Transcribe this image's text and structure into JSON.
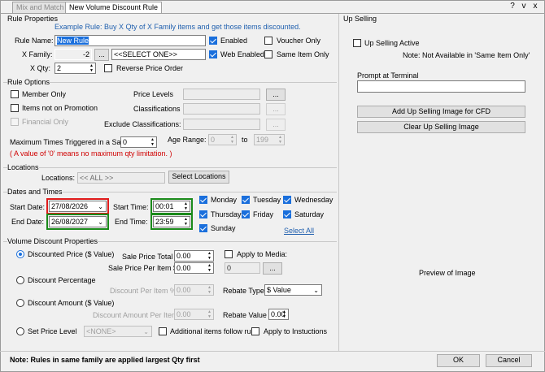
{
  "tabs": [
    "Mix and Match",
    "New Volume Discount Rule"
  ],
  "window_controls": {
    "help": "?",
    "min": "v",
    "close": "x"
  },
  "rule_properties": {
    "title": "Rule Properties",
    "example": "Example Rule: Buy X Qty of X Family items and get those items discounted.",
    "rule_name_label": "Rule Name:",
    "rule_name_value": "New Rule",
    "x_family_label": "X Family:",
    "x_family_value": "-2",
    "x_family_btn": "...",
    "x_family_select": "<<SELECT ONE>>",
    "x_qty_label": "X Qty:",
    "x_qty_value": "2",
    "reverse_price_order": "Reverse Price Order",
    "enabled": "Enabled",
    "web_enabled": "Web Enabled",
    "voucher_only": "Voucher Only",
    "same_item_only": "Same Item Only"
  },
  "rule_options": {
    "title": "Rule Options",
    "member_only": "Member Only",
    "items_not_on_promotion": "Items not on Promotion",
    "financial_only": "Financial Only",
    "price_levels": "Price Levels",
    "classifications": "Classifications",
    "exclude_classifications": "Exclude Classifications:",
    "browse_btn": "...",
    "max_times_label": "Maximum Times Triggered in a Sale:",
    "max_times_value": "0",
    "max_times_note": "( A value of '0' means no maximum qty limitation. )",
    "age_range_label": "Age Range:",
    "age_from": "0",
    "age_to_label": "to",
    "age_to": "199"
  },
  "locations": {
    "title": "Locations",
    "label": "Locations:",
    "value": "<< ALL >>",
    "select_btn": "Select Locations"
  },
  "dates_times": {
    "title": "Dates and Times",
    "start_date_label": "Start Date:",
    "start_date": "27/08/2026",
    "end_date_label": "End Date:",
    "end_date": "26/08/2027",
    "start_time_label": "Start Time:",
    "start_time": "00:01",
    "end_time_label": "End Time:",
    "end_time": "23:59",
    "days": [
      "Monday",
      "Tuesday",
      "Wednesday",
      "Thursday",
      "Friday",
      "Saturday",
      "Sunday"
    ],
    "select_all": "Select All"
  },
  "volume_discount": {
    "title": "Volume Discount Properties",
    "discounted_price": "Discounted Price ($ Value)",
    "sale_price_total_label": "Sale Price Total",
    "sale_price_total": "0.00",
    "sale_price_per_item_label": "Sale Price Per Item $",
    "sale_price_per_item": "0.00",
    "apply_to_media": "Apply to Media:",
    "media_value": "0",
    "media_btn": "...",
    "discount_percentage": "Discount Percentage",
    "discount_per_item_pct_label": "Discount Per Item %",
    "discount_per_item_pct": "0.00",
    "rebate_type_label": "Rebate Type",
    "rebate_type_value": "$ Value",
    "discount_amount": "Discount Amount ($ Value)",
    "discount_amount_per_item_label": "Discount Amount Per Item",
    "discount_amount_per_item": "0.00",
    "rebate_value_label": "Rebate Value",
    "rebate_value": "0.00",
    "set_price_level": "Set Price Level",
    "price_level_select": "<NONE>",
    "additional_items": "Additional items follow rule",
    "apply_to_instructions": "Apply to Instuctions"
  },
  "up_selling": {
    "title": "Up Selling",
    "active": "Up Selling Active",
    "note": "Note: Not Available in 'Same Item Only'",
    "prompt_label": "Prompt at Terminal",
    "add_image_btn": "Add Up Selling Image for CFD",
    "clear_image_btn": "Clear Up Selling Image",
    "preview": "Preview of Image"
  },
  "footer": {
    "note": "Note: Rules in same family are applied largest Qty first",
    "ok": "OK",
    "cancel": "Cancel"
  },
  "colors": {
    "accent": "#1a6fdc",
    "highlight_red": "#e01b1b",
    "highlight_green": "#1a8a1a",
    "note_red": "#d00000",
    "link_blue": "#1f5fae"
  }
}
